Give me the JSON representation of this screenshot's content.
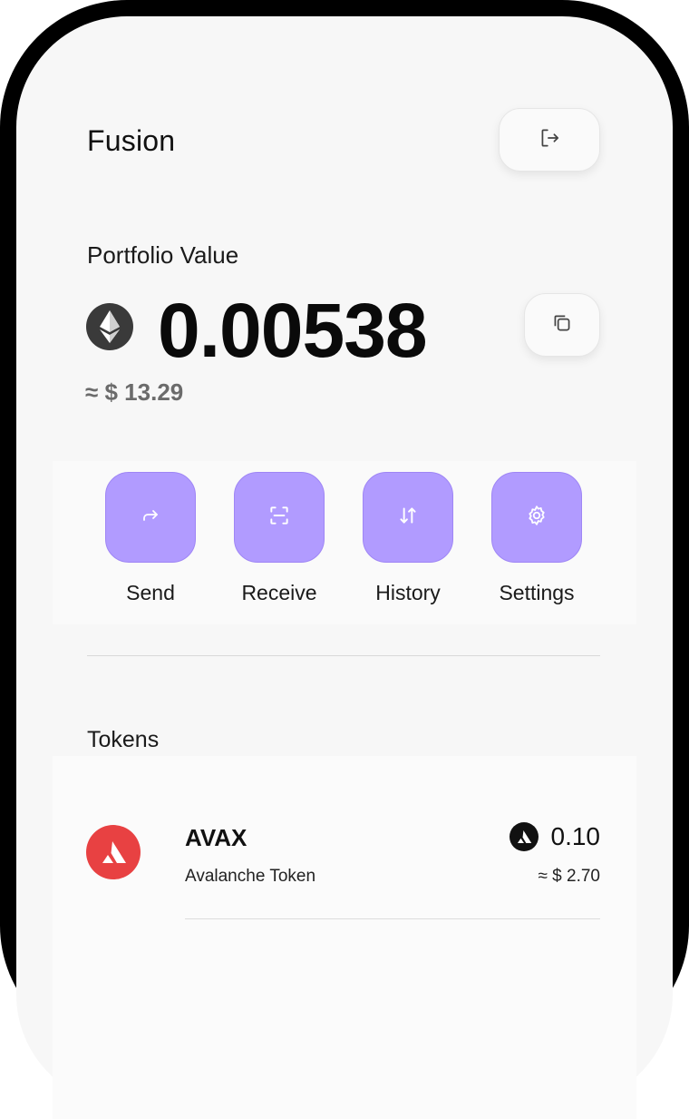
{
  "header": {
    "title": "Fusion",
    "logout_icon": "logout-icon"
  },
  "portfolio": {
    "label": "Portfolio Value",
    "currency_icon": "ethereum-icon",
    "balance": "0.00538",
    "usd_value": "≈ $ 13.29",
    "copy_icon": "copy-icon"
  },
  "actions": [
    {
      "label": "Send",
      "icon": "send-arrow-icon"
    },
    {
      "label": "Receive",
      "icon": "scan-icon"
    },
    {
      "label": "History",
      "icon": "sort-arrows-icon"
    },
    {
      "label": "Settings",
      "icon": "gear-icon"
    }
  ],
  "tokens": {
    "heading": "Tokens",
    "items": [
      {
        "symbol": "AVAX",
        "name": "Avalanche Token",
        "amount": "0.10",
        "usd_value": "≈ $ 2.70",
        "icon": "avalanche-icon"
      }
    ]
  },
  "colors": {
    "accent": "#b19bff",
    "avalanche": "#e84142",
    "background": "#f7f7f7",
    "frame": "#000000"
  }
}
